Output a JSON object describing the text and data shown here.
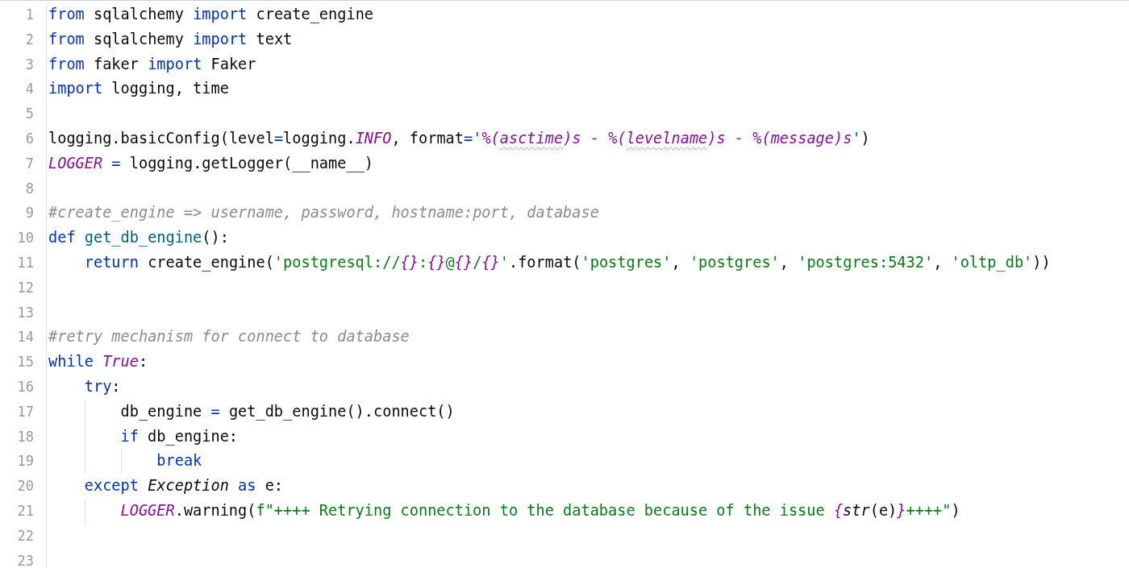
{
  "editor": {
    "lines": [
      {
        "number": "1",
        "tokens": [
          {
            "kind": "kw",
            "text": "from"
          },
          {
            "kind": "plain",
            "text": " sqlalchemy "
          },
          {
            "kind": "kw",
            "text": "import"
          },
          {
            "kind": "plain",
            "text": " create_engine"
          }
        ]
      },
      {
        "number": "2",
        "tokens": [
          {
            "kind": "kw",
            "text": "from"
          },
          {
            "kind": "plain",
            "text": " sqlalchemy "
          },
          {
            "kind": "kw",
            "text": "import"
          },
          {
            "kind": "plain",
            "text": " text"
          }
        ]
      },
      {
        "number": "3",
        "tokens": [
          {
            "kind": "kw",
            "text": "from"
          },
          {
            "kind": "plain",
            "text": " faker "
          },
          {
            "kind": "kw",
            "text": "import"
          },
          {
            "kind": "plain",
            "text": " Faker"
          }
        ]
      },
      {
        "number": "4",
        "tokens": [
          {
            "kind": "kw",
            "text": "import"
          },
          {
            "kind": "plain",
            "text": " logging, time"
          }
        ]
      },
      {
        "number": "5"
      },
      {
        "number": "6",
        "tokens": [
          {
            "kind": "plain",
            "text": "logging.basicConfig(level"
          },
          {
            "kind": "op",
            "text": "="
          },
          {
            "kind": "plain",
            "text": "logging."
          },
          {
            "kind": "const",
            "text": "INFO"
          },
          {
            "kind": "plain",
            "text": ", format"
          },
          {
            "kind": "op",
            "text": "="
          },
          {
            "kind": "str",
            "text": "'"
          },
          {
            "kind": "fmt",
            "text": "%("
          },
          {
            "kind": "fmtw",
            "text": "asctime"
          },
          {
            "kind": "fmt",
            "text": ")s - %("
          },
          {
            "kind": "fmtw",
            "text": "levelname"
          },
          {
            "kind": "fmt",
            "text": ")s - %(message)s"
          },
          {
            "kind": "str",
            "text": "'"
          },
          {
            "kind": "plain",
            "text": ")"
          }
        ]
      },
      {
        "number": "7",
        "tokens": [
          {
            "kind": "const",
            "text": "LOGGER"
          },
          {
            "kind": "op",
            "text": " = "
          },
          {
            "kind": "plain",
            "text": "logging.getLogger(__name__)"
          }
        ]
      },
      {
        "number": "8"
      },
      {
        "number": "9",
        "tokens": [
          {
            "kind": "cmt",
            "text": "#create_engine => username, password, hostname:port, database"
          }
        ]
      },
      {
        "number": "10",
        "tokens": [
          {
            "kind": "kw",
            "text": "def "
          },
          {
            "kind": "fn",
            "text": "get_db_engine"
          },
          {
            "kind": "plain",
            "text": "():"
          }
        ]
      },
      {
        "number": "11",
        "tokens": [
          {
            "kind": "space"
          },
          {
            "kind": "kw",
            "text": "return"
          },
          {
            "kind": "plain",
            "text": " create_engine("
          },
          {
            "kind": "str",
            "text": "'postgresql://"
          },
          {
            "kind": "fmt",
            "text": "{}"
          },
          {
            "kind": "str",
            "text": ":"
          },
          {
            "kind": "fmt",
            "text": "{}"
          },
          {
            "kind": "str",
            "text": "@"
          },
          {
            "kind": "fmt",
            "text": "{}"
          },
          {
            "kind": "str",
            "text": "/"
          },
          {
            "kind": "fmt",
            "text": "{}"
          },
          {
            "kind": "str",
            "text": "'"
          },
          {
            "kind": "plain",
            "text": ".format("
          },
          {
            "kind": "str",
            "text": "'postgres'"
          },
          {
            "kind": "plain",
            "text": ", "
          },
          {
            "kind": "str",
            "text": "'postgres'"
          },
          {
            "kind": "plain",
            "text": ", "
          },
          {
            "kind": "str",
            "text": "'postgres:5432'"
          },
          {
            "kind": "plain",
            "text": ", "
          },
          {
            "kind": "str",
            "text": "'oltp_db'"
          },
          {
            "kind": "plain",
            "text": "))"
          }
        ]
      },
      {
        "number": "12"
      },
      {
        "number": "13"
      },
      {
        "number": "14",
        "tokens": [
          {
            "kind": "cmt",
            "text": "#retry mechanism for connect to database"
          }
        ]
      },
      {
        "number": "15",
        "tokens": [
          {
            "kind": "kw",
            "text": "while "
          },
          {
            "kind": "const",
            "text": "True"
          },
          {
            "kind": "plain",
            "text": ":"
          }
        ]
      },
      {
        "number": "16",
        "tokens": [
          {
            "kind": "space"
          },
          {
            "kind": "kw",
            "text": "try"
          },
          {
            "kind": "plain",
            "text": ":"
          }
        ]
      },
      {
        "number": "17",
        "tokens": [
          {
            "kind": "space"
          },
          {
            "kind": "guide"
          },
          {
            "kind": "plain",
            "text": "db_engine "
          },
          {
            "kind": "op",
            "text": "="
          },
          {
            "kind": "plain",
            "text": " get_db_engine().connect()"
          }
        ]
      },
      {
        "number": "18",
        "tokens": [
          {
            "kind": "space"
          },
          {
            "kind": "guide"
          },
          {
            "kind": "kw",
            "text": "if"
          },
          {
            "kind": "plain",
            "text": " db_engine:"
          }
        ]
      },
      {
        "number": "19",
        "tokens": [
          {
            "kind": "space"
          },
          {
            "kind": "guide"
          },
          {
            "kind": "guide"
          },
          {
            "kind": "kw",
            "text": "break"
          }
        ]
      },
      {
        "number": "20",
        "tokens": [
          {
            "kind": "space"
          },
          {
            "kind": "kw",
            "text": "except "
          },
          {
            "kind": "italic",
            "text": "Exception "
          },
          {
            "kind": "kw",
            "text": "as"
          },
          {
            "kind": "plain",
            "text": " e:"
          }
        ]
      },
      {
        "number": "21",
        "tokens": [
          {
            "kind": "space"
          },
          {
            "kind": "guide"
          },
          {
            "kind": "const",
            "text": "LOGGER"
          },
          {
            "kind": "plain",
            "text": ".warning("
          },
          {
            "kind": "str",
            "text": "f\"++++ Retrying connection to the database because of the issue "
          },
          {
            "kind": "fmt",
            "text": "{"
          },
          {
            "kind": "italic",
            "text": "str"
          },
          {
            "kind": "plain",
            "text": "(e)"
          },
          {
            "kind": "fmt",
            "text": "}"
          },
          {
            "kind": "str",
            "text": "++++\""
          },
          {
            "kind": "plain",
            "text": ")"
          }
        ]
      },
      {
        "number": "22"
      },
      {
        "number": "23"
      }
    ]
  }
}
